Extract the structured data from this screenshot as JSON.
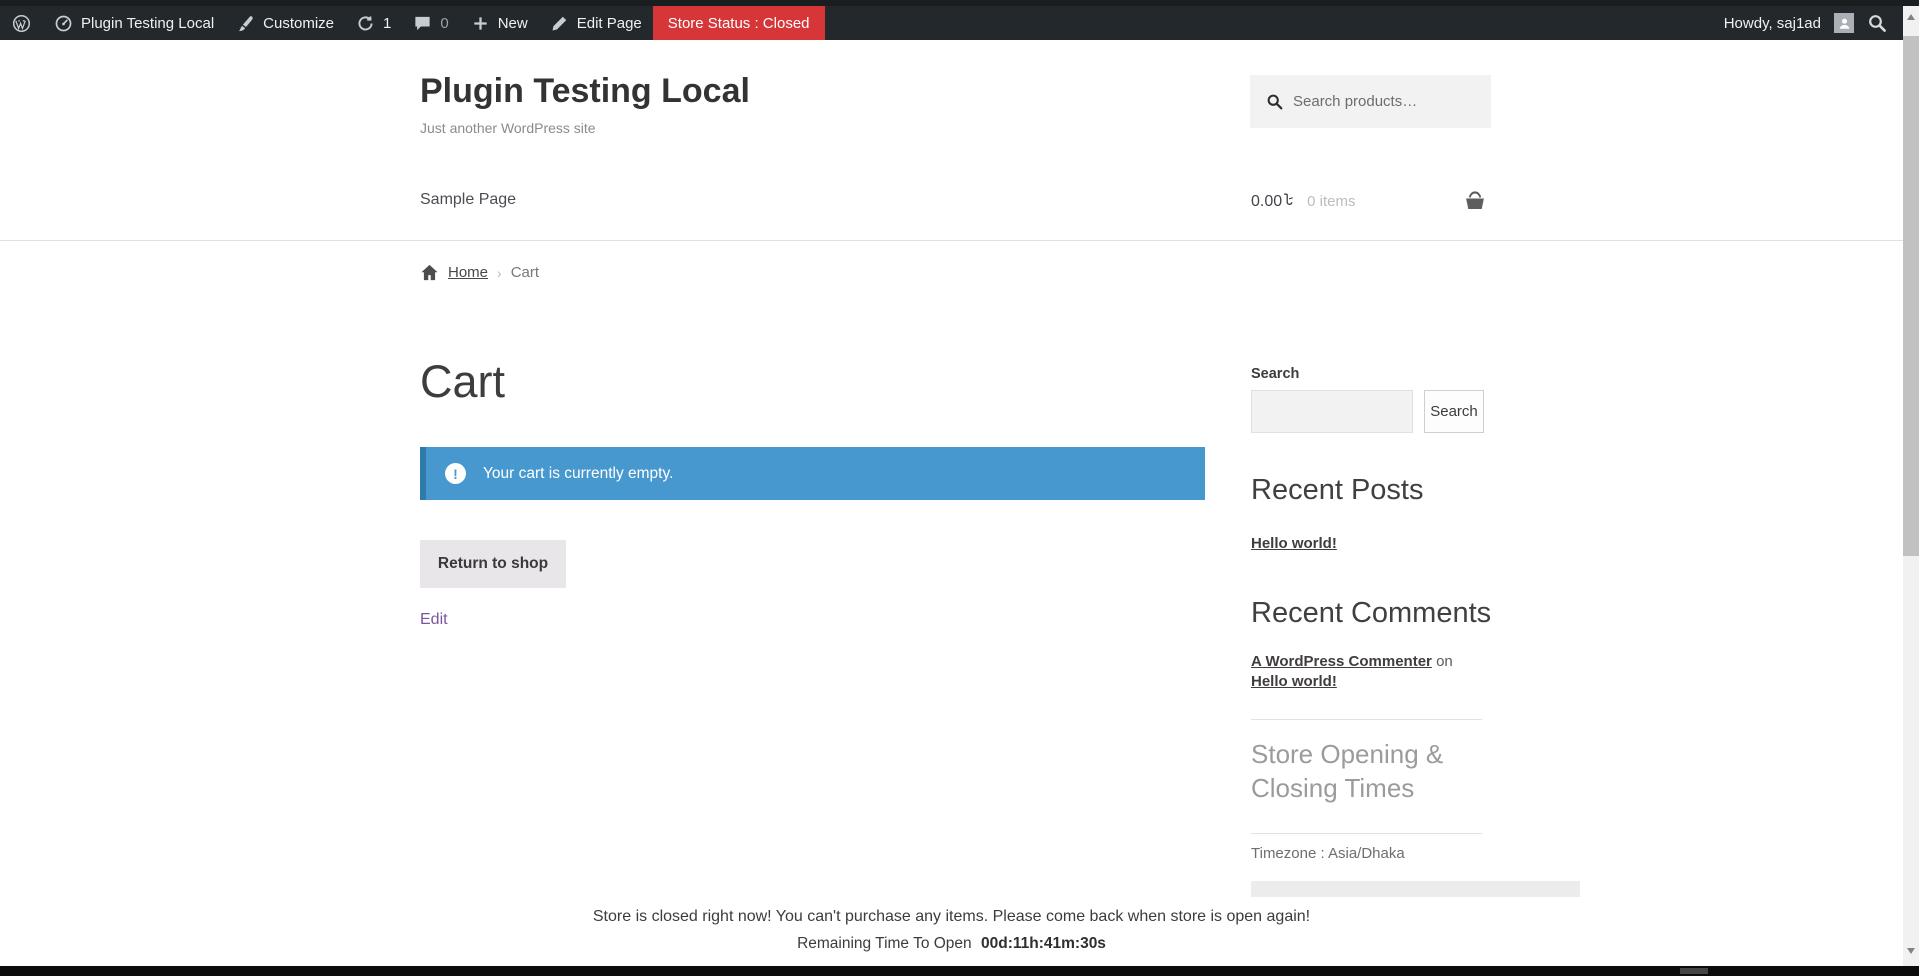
{
  "admin_bar": {
    "site_name": "Plugin Testing Local",
    "customize_label": "Customize",
    "updates_count": "1",
    "comments_count": "0",
    "new_label": "New",
    "edit_page_label": "Edit Page",
    "store_status_label": "Store Status : Closed",
    "howdy_label": "Howdy, saj1ad"
  },
  "header": {
    "site_title": "Plugin Testing Local",
    "tagline": "Just another WordPress site",
    "search_placeholder": "Search products…",
    "nav": [
      {
        "label": "Sample Page"
      }
    ],
    "cart": {
      "amount": "0.00",
      "currency_symbol": "৳",
      "items_label": "0 items"
    }
  },
  "breadcrumb": {
    "home_label": "Home",
    "separator": "›",
    "current": "Cart"
  },
  "main": {
    "page_title": "Cart",
    "notice_icon_glyph": "!",
    "notice_text": "Your cart is currently empty.",
    "return_to_shop_label": "Return to shop",
    "edit_label": "Edit"
  },
  "sidebar": {
    "search_label": "Search",
    "search_value": "",
    "search_button_label": "Search",
    "recent_posts_title": "Recent Posts",
    "recent_posts": [
      {
        "label": "Hello world!"
      }
    ],
    "recent_comments_title": "Recent Comments",
    "recent_comments": [
      {
        "author": "A WordPress Commenter",
        "connector": "on",
        "post": "Hello world!"
      }
    ],
    "store_times_title": "Store Opening & Closing Times",
    "timezone_label": "Timezone : Asia/Dhaka"
  },
  "footer_notice": {
    "message": "Store is closed right now! You can't purchase any items. Please come back when store is open again!",
    "countdown_prefix": "Remaining Time To Open",
    "countdown_value": "00d:11h:41m:30s"
  },
  "colors": {
    "admin_bar_bg": "#23282d",
    "store_status_bg": "#d63638",
    "notice_bg": "#4798ce",
    "notice_border": "#2e7bab",
    "edit_link": "#7d54a0"
  }
}
